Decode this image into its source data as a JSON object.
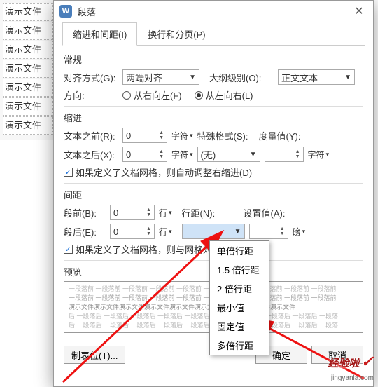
{
  "bg_items": [
    "演示文件",
    "演示文件",
    "演示文件",
    "演示文件",
    "演示文件",
    "演示文件",
    "演示文件"
  ],
  "title": "段落",
  "tabs": {
    "t1": "缩进和间距(I)",
    "t2": "换行和分页(P)"
  },
  "general": {
    "header": "常规",
    "align_label": "对齐方式(G):",
    "align_value": "两端对齐",
    "outline_label": "大纲级别(O):",
    "outline_value": "正文文本",
    "dir_label": "方向:",
    "dir_rtl": "从右向左(F)",
    "dir_ltr": "从左向右(L)"
  },
  "indent": {
    "header": "缩进",
    "before_label": "文本之前(R):",
    "before_value": "0",
    "after_label": "文本之后(X):",
    "after_value": "0",
    "unit": "字符",
    "special_label": "特殊格式(S):",
    "special_value": "(无)",
    "measure_label": "度量值(Y):",
    "measure_unit": "字符",
    "grid_check": "如果定义了文档网格，则自动调整右缩进(D)"
  },
  "spacing": {
    "header": "间距",
    "before_label": "段前(B):",
    "before_value": "0",
    "after_label": "段后(E):",
    "after_value": "0",
    "unit": "行",
    "lh_label": "行距(N):",
    "lh_value": "",
    "set_label": "设置值(A):",
    "set_value": "",
    "set_unit": "磅",
    "grid_check": "如果定义了文档网格，则与网格对",
    "options": [
      "单倍行距",
      "1.5 倍行距",
      "2 倍行距",
      "最小值",
      "固定值",
      "多倍行距"
    ]
  },
  "preview": {
    "header": "预览",
    "line_prev": "一段落前 一段落前 一段落前 一段落前 一段落前 一段落前 一段落前 一段落前 一段落前 一段落前",
    "line_body": "演示文件演示文件演示文件演示文件演示文件演示文件演示文件演示文件演示文件",
    "line_after": "后 一段落后 一段落后 一段落后 一段落后 一段落后 一段落后 一段落后 一段落后 一段落后 一段落"
  },
  "buttons": {
    "tabs": "制表位(T)...",
    "ok": "确定",
    "cancel": "取消"
  },
  "watermark": {
    "brand": "经验啦",
    "url": "jingyanla.com"
  }
}
